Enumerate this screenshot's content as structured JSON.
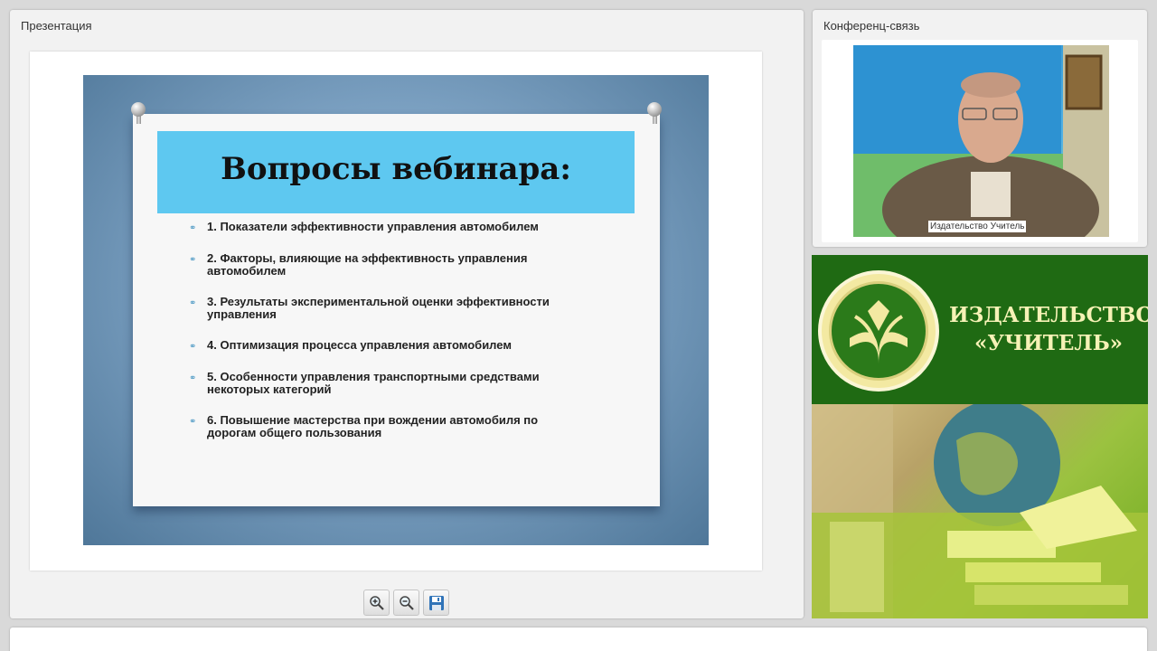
{
  "presentation": {
    "title": "Презентация",
    "slide": {
      "heading": "Вопросы вебинара:",
      "items": [
        {
          "line1": "1. Показатели эффективности управления автомобилем",
          "line2": ""
        },
        {
          "line1": "2. Факторы, влияющие на эффективность управления",
          "line2": "автомобилем"
        },
        {
          "line1": "3. Результаты экспериментальной оценки эффективности",
          "line2": "управления"
        },
        {
          "line1": "4. Оптимизация  процесса управления автомобилем",
          "line2": ""
        },
        {
          "line1": " 5. Особенности управления транспортными средствами",
          "line2": "некоторых категорий"
        },
        {
          "line1": "6. Повышение мастерства при вождении автомобиля по",
          "line2": "дорогам общего пользования"
        }
      ]
    },
    "toolbar": {
      "zoom_in_icon": "zoom-in-icon",
      "zoom_out_icon": "zoom-out-icon",
      "save_icon": "floppy-disk-icon"
    }
  },
  "conference": {
    "title": "Конференц-связь",
    "speaker_label": "Издательство Учитель"
  },
  "banner": {
    "line1": "ИЗДАТЕЛЬСТВО",
    "line2": "«УЧИТЕЛЬ»"
  },
  "colors": {
    "slide_title_bar": "#5ec8f0",
    "banner_green": "#1f6a13",
    "banner_text": "#f6f2b6"
  }
}
